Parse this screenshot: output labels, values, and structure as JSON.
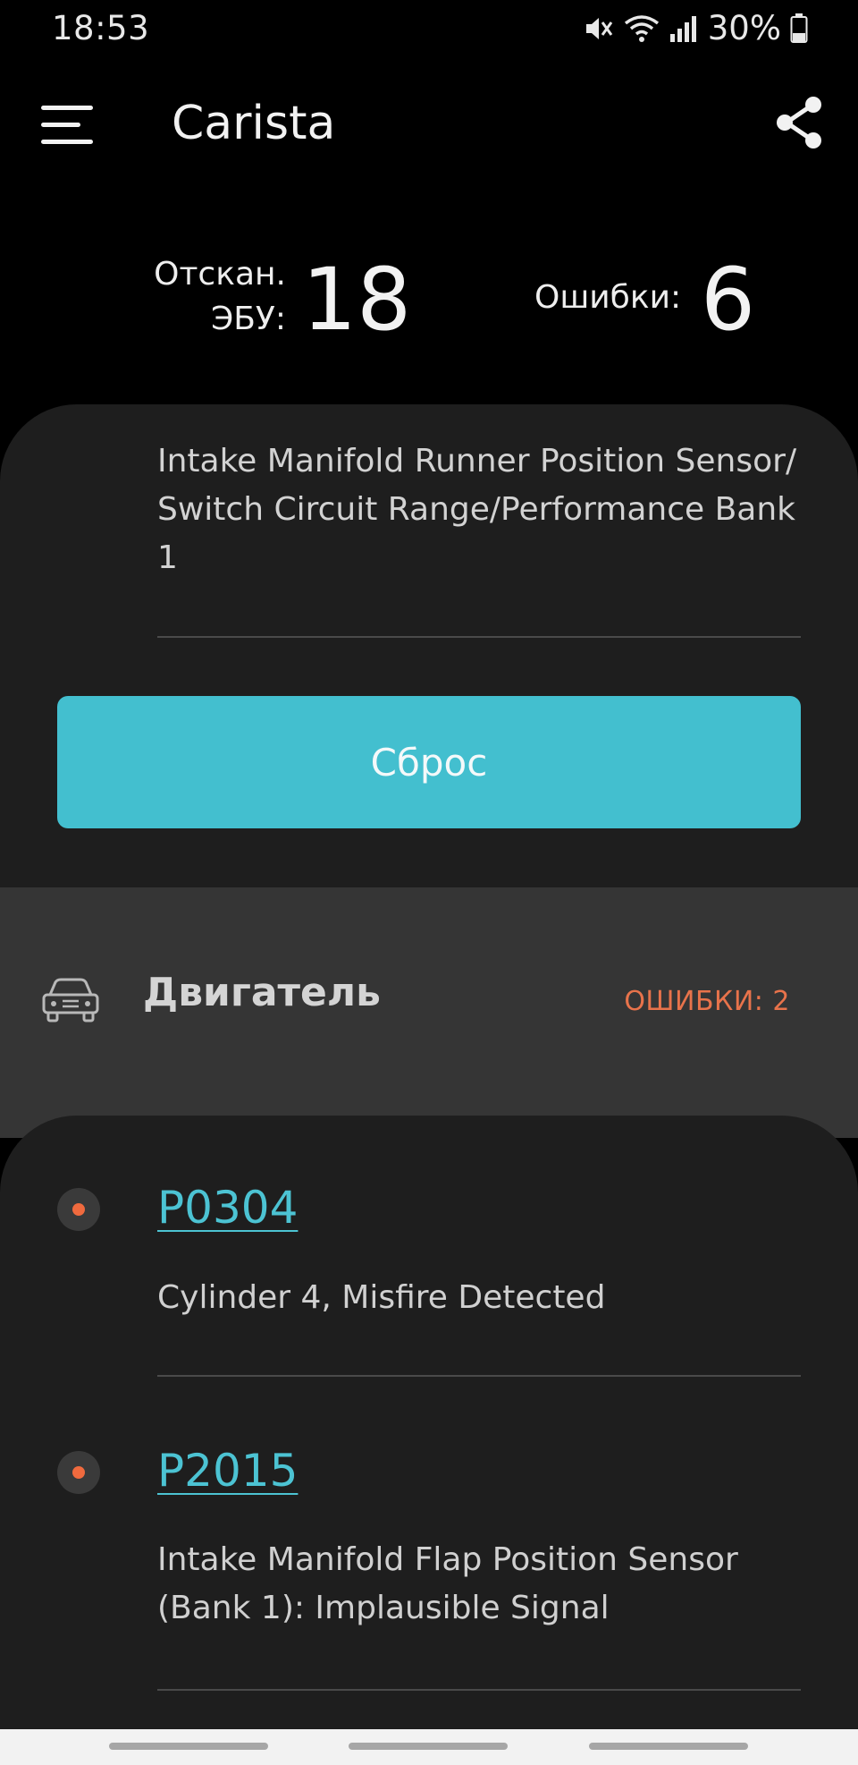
{
  "status_bar": {
    "time": "18:53",
    "battery": "30%",
    "icons": [
      "mute-icon",
      "wifi-icon",
      "signal-icon",
      "battery-icon"
    ]
  },
  "app_bar": {
    "title": "Carista",
    "menu_icon": "hamburger-menu-icon",
    "share_icon": "share-icon"
  },
  "summary": {
    "scanned_label_line1": "Отскан.",
    "scanned_label_line2": "ЭБУ:",
    "scanned_value": "18",
    "errors_label": "Ошибки:",
    "errors_value": "6"
  },
  "top_card": {
    "description": "Intake Manifold Runner Position Sensor/ Switch Circuit Range/Performance Bank 1",
    "reset_label": "Сброс"
  },
  "section": {
    "icon": "car-icon",
    "title": "Двигатель",
    "error_count": "ОШИБКИ: 2"
  },
  "dtc_list": [
    {
      "code": "P0304",
      "description": "Cylinder 4, Misfire Detected"
    },
    {
      "code": "P2015",
      "description": "Intake Manifold Flap Position Sensor (Bank 1): Implausible Signal"
    }
  ],
  "colors": {
    "accent": "#43bfcf",
    "link": "#4cc3d3",
    "error": "#e8734b",
    "card": "#1e1e1e",
    "section": "#353535"
  }
}
